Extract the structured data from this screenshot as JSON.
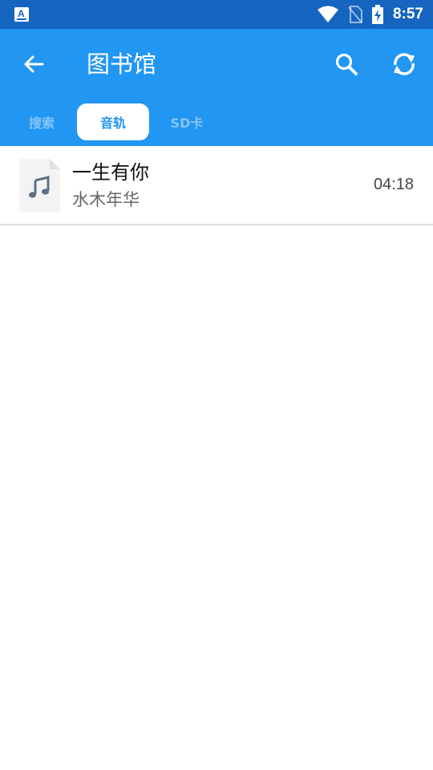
{
  "status_bar": {
    "time": "8:57",
    "icons": [
      "app-notification-icon",
      "wifi-icon",
      "no-sim-icon",
      "battery-charging-icon"
    ]
  },
  "app_bar": {
    "title": "图书馆",
    "back_icon": "arrow-left-icon",
    "search_icon": "search-icon",
    "sync_icon": "sync-icon"
  },
  "tabs": [
    {
      "label": "搜索",
      "selected": false
    },
    {
      "label": "音轨",
      "selected": true
    },
    {
      "label": "SD卡",
      "selected": false
    }
  ],
  "tracks": [
    {
      "title": "一生有你",
      "artist": "水木年华",
      "duration": "04:18",
      "icon": "music-file-icon"
    }
  ],
  "colors": {
    "status_bar": "#1565c0",
    "app_bar": "#2196f3",
    "tab_selected_bg": "#ffffff",
    "tab_selected_text": "#2196f3",
    "divider": "#dddddd"
  }
}
